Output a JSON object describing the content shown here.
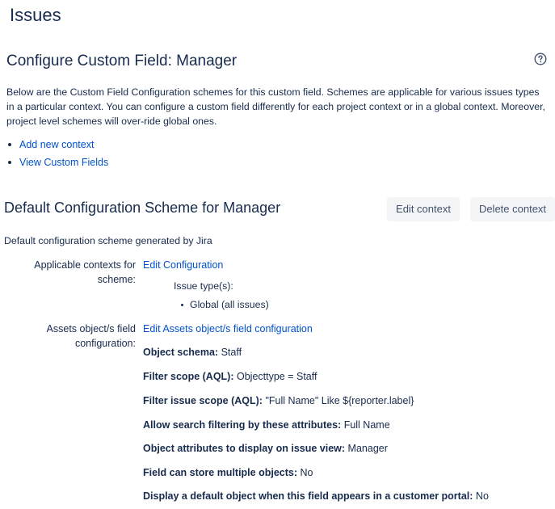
{
  "header": {
    "title": "Issues"
  },
  "section": {
    "title": "Configure Custom Field: Manager",
    "description": "Below are the Custom Field Configuration schemes for this custom field. Schemes are applicable for various issues types in a particular context. You can configure a custom field differently for each project context or in a global context. Moreover, project level schemes will over-ride global ones.",
    "links": [
      "Add new context",
      "View Custom Fields"
    ]
  },
  "scheme": {
    "title": "Default Configuration Scheme for Manager",
    "edit_button": "Edit context",
    "delete_button": "Delete context",
    "description": "Default configuration scheme generated by Jira",
    "contexts": {
      "label_line1": "Applicable contexts for",
      "label_line2": "scheme:",
      "link": "Edit Configuration",
      "issue_types_label": "Issue type(s):",
      "issue_types": [
        "Global (all issues)"
      ]
    },
    "assets": {
      "label_line1": "Assets object/s field",
      "label_line2": "configuration:",
      "link": "Edit Assets object/s field configuration",
      "rows": [
        {
          "key": "Object schema:",
          "value": "Staff"
        },
        {
          "key": "Filter scope (AQL):",
          "value": "Objecttype = Staff"
        },
        {
          "key": "Filter issue scope (AQL):",
          "value": "\"Full Name\" Like ${reporter.label}"
        },
        {
          "key": "Allow search filtering by these attributes:",
          "value": "Full Name"
        },
        {
          "key": "Object attributes to display on issue view:",
          "value": "Manager"
        },
        {
          "key": "Field can store multiple objects:",
          "value": "No"
        },
        {
          "key": "Display a default object when this field appears in a customer portal:",
          "value": "No"
        }
      ]
    }
  }
}
